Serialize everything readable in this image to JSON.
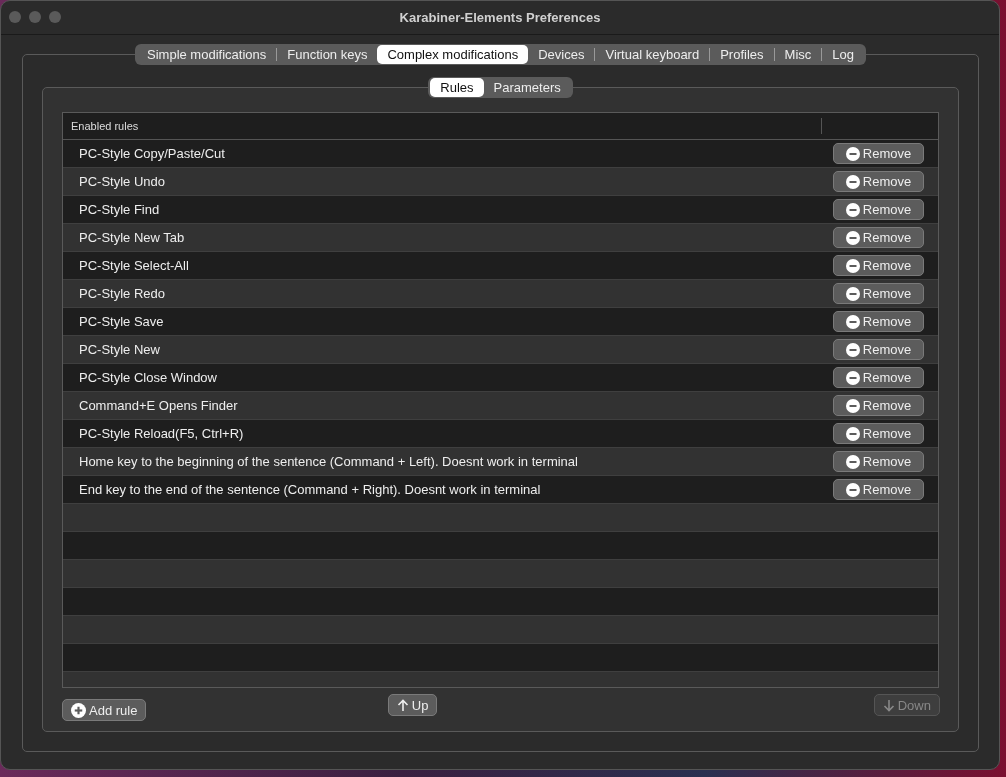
{
  "window": {
    "title": "Karabiner-Elements Preferences"
  },
  "tabs": [
    {
      "label": "Simple modifications",
      "selected": false
    },
    {
      "label": "Function keys",
      "selected": false
    },
    {
      "label": "Complex modifications",
      "selected": true
    },
    {
      "label": "Devices",
      "selected": false
    },
    {
      "label": "Virtual keyboard",
      "selected": false
    },
    {
      "label": "Profiles",
      "selected": false
    },
    {
      "label": "Misc",
      "selected": false
    },
    {
      "label": "Log",
      "selected": false
    }
  ],
  "subtabs": [
    {
      "label": "Rules",
      "selected": true
    },
    {
      "label": "Parameters",
      "selected": false
    }
  ],
  "table": {
    "columns": [
      "Enabled rules"
    ],
    "rows": [
      {
        "name": "PC-Style Copy/Paste/Cut",
        "action": "Remove"
      },
      {
        "name": "PC-Style Undo",
        "action": "Remove"
      },
      {
        "name": "PC-Style Find",
        "action": "Remove"
      },
      {
        "name": "PC-Style New Tab",
        "action": "Remove"
      },
      {
        "name": "PC-Style Select-All",
        "action": "Remove"
      },
      {
        "name": "PC-Style Redo",
        "action": "Remove"
      },
      {
        "name": "PC-Style Save",
        "action": "Remove"
      },
      {
        "name": "PC-Style New",
        "action": "Remove"
      },
      {
        "name": "PC-Style Close Window",
        "action": "Remove"
      },
      {
        "name": "Command+E Opens Finder",
        "action": "Remove"
      },
      {
        "name": "PC-Style Reload(F5, Ctrl+R)",
        "action": "Remove"
      },
      {
        "name": "Home key to the beginning of the sentence (Command + Left). Doesnt work in terminal",
        "action": "Remove"
      },
      {
        "name": "End key to the end of the sentence (Command + Right). Doesnt work in terminal",
        "action": "Remove"
      }
    ]
  },
  "buttons": [
    {
      "kind": "add",
      "label": "Add rule",
      "disabled": false
    },
    {
      "kind": "up",
      "label": "Up",
      "disabled": false
    },
    {
      "kind": "down",
      "label": "Down",
      "disabled": true
    }
  ]
}
